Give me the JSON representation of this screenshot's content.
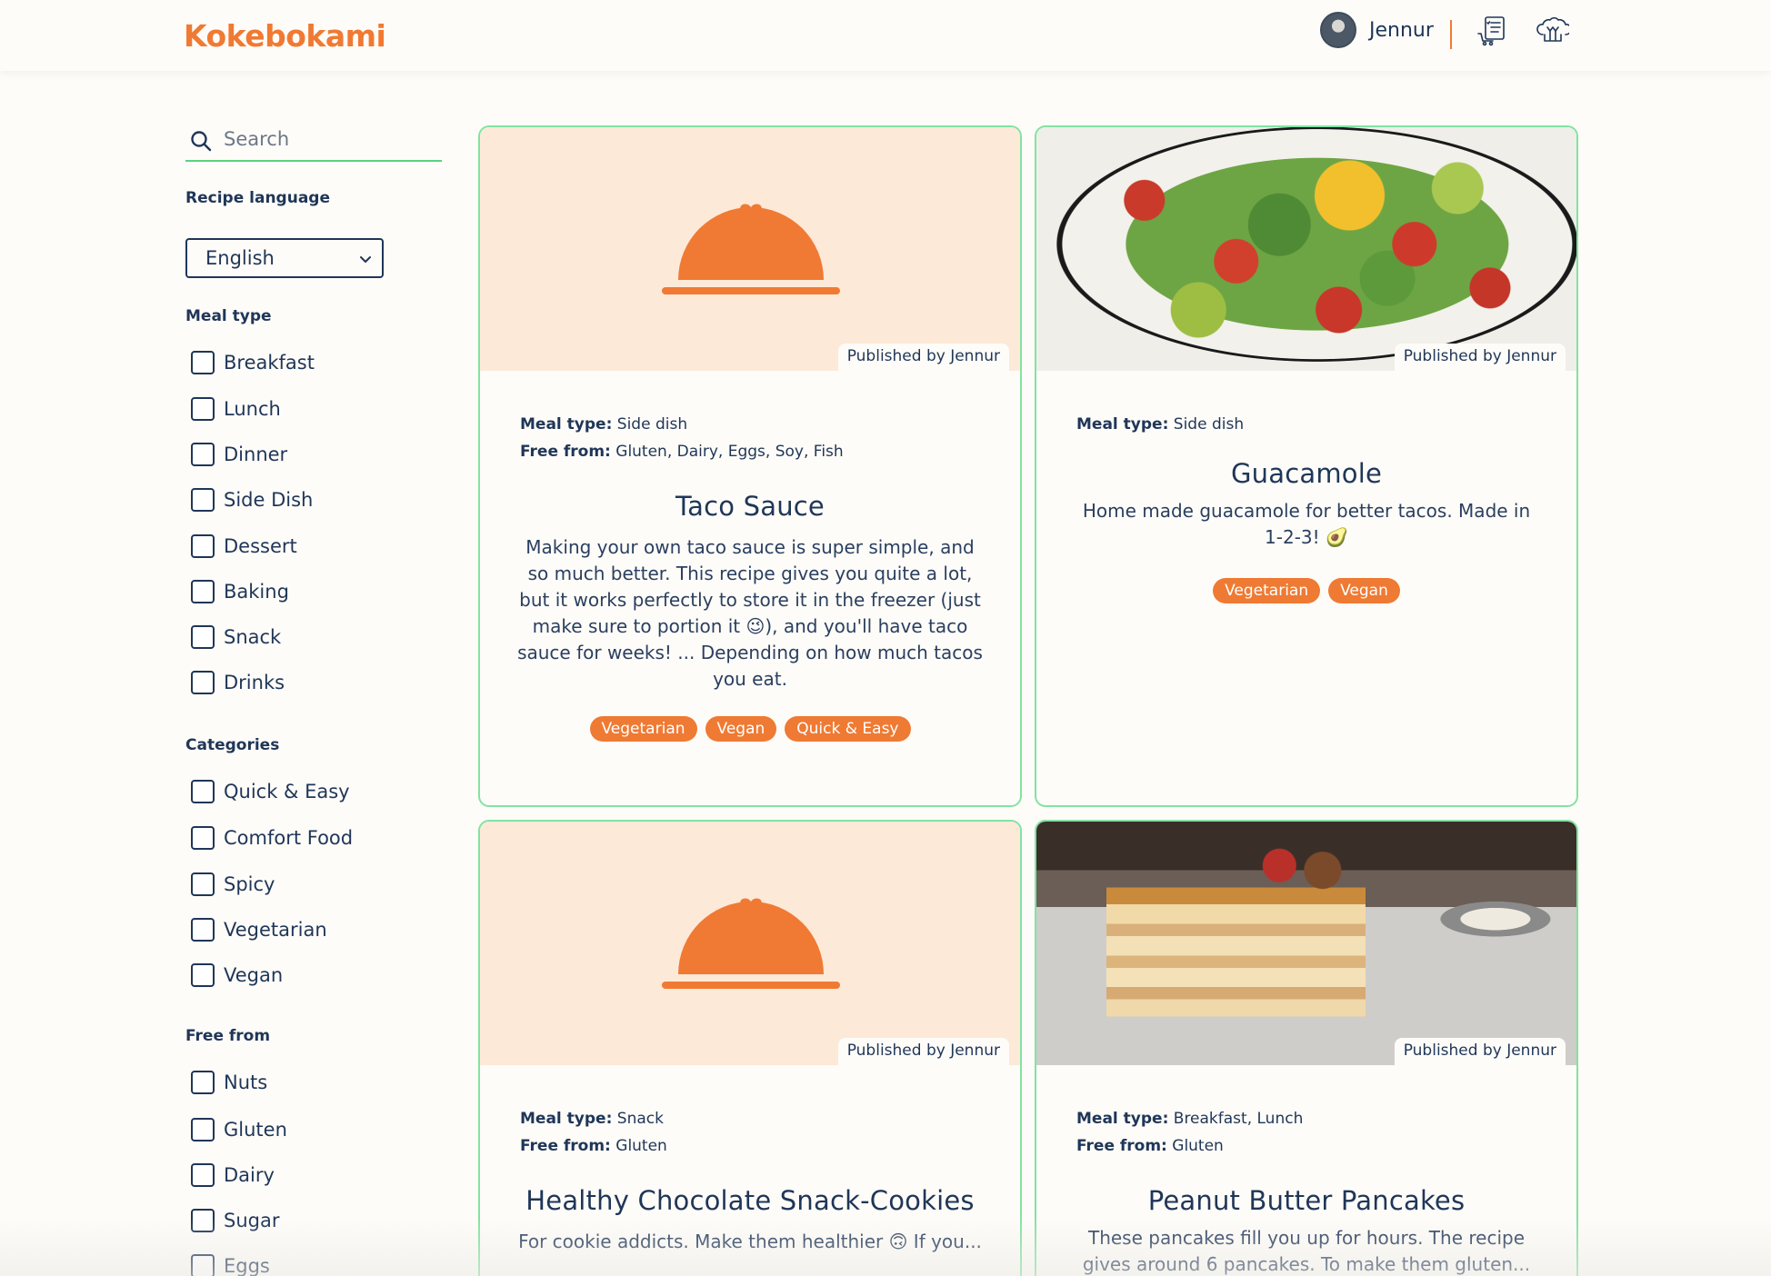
{
  "header": {
    "logo": "Kokebokami",
    "user_name": "Jennur",
    "icons": [
      "shopping-list-icon",
      "chef-hat-icon"
    ]
  },
  "sidebar": {
    "search_placeholder": "Search",
    "language_title": "Recipe language",
    "language_selected": "English",
    "meal_type_title": "Meal type",
    "meal_types": [
      "Breakfast",
      "Lunch",
      "Dinner",
      "Side Dish",
      "Dessert",
      "Baking",
      "Snack",
      "Drinks"
    ],
    "categories_title": "Categories",
    "categories": [
      "Quick & Easy",
      "Comfort Food",
      "Spicy",
      "Vegetarian",
      "Vegan"
    ],
    "free_from_title": "Free from",
    "free_from": [
      "Nuts",
      "Gluten",
      "Dairy",
      "Sugar",
      "Eggs"
    ]
  },
  "labels": {
    "meal_type": "Meal type:",
    "free_from": "Free from:"
  },
  "recipes": [
    {
      "image": "placeholder-cloche",
      "published": "Published by Jennur",
      "meal_type": "Side dish",
      "free_from": "Gluten, Dairy, Eggs, Soy, Fish",
      "title": "Taco Sauce",
      "description": "Making your own taco sauce is super simple, and so much better. This recipe gives you quite a lot, but it works perfectly to store it in the freezer (just make sure to portion it 😉), and you'll have taco sauce for weeks! ... Depending on how much tacos you eat.",
      "tags": [
        "Vegetarian",
        "Vegan",
        "Quick & Easy"
      ]
    },
    {
      "image": "photo-salad",
      "published": "Published by Jennur",
      "meal_type": "Side dish",
      "free_from": "",
      "title": "Guacamole",
      "description": "Home made guacamole for better tacos. Made in 1-2-3! 🥑",
      "tags": [
        "Vegetarian",
        "Vegan"
      ]
    },
    {
      "image": "placeholder-cloche",
      "published": "Published by Jennur",
      "meal_type": "Snack",
      "free_from": "Gluten",
      "title": "Healthy Chocolate Snack-Cookies",
      "description": "For cookie addicts. Make them healthier 🙃 If you...",
      "tags": []
    },
    {
      "image": "photo-pancake",
      "published": "Published by Jennur",
      "meal_type": "Breakfast, Lunch",
      "free_from": "Gluten",
      "title": "Peanut Butter Pancakes",
      "description": "These pancakes fill you up for hours. The recipe gives around 6 pancakes. To make them gluten...",
      "tags": []
    }
  ],
  "colors": {
    "accent": "#ef7a33",
    "navy": "#1f3658",
    "card_border": "#82e3a2",
    "placeholder_bg": "#fde9d8"
  }
}
